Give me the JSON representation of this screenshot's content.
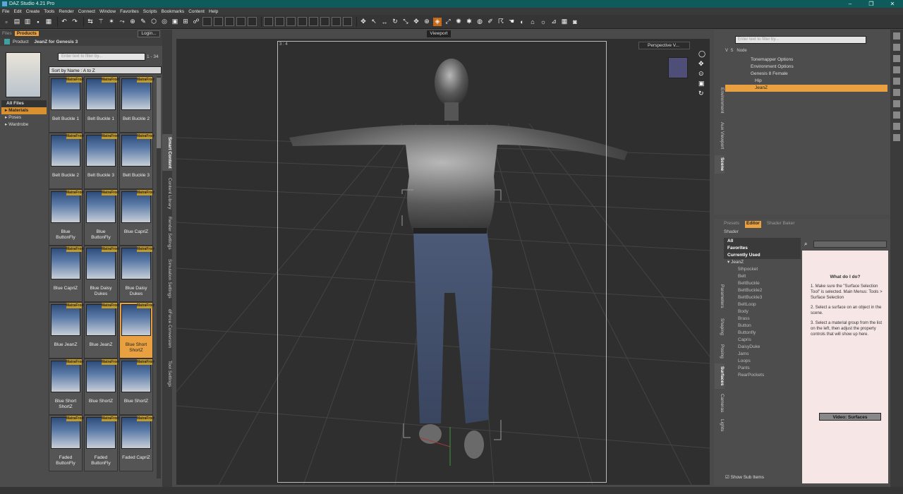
{
  "window": {
    "title": "DAZ Studio 4.21 Pro",
    "controls": [
      "–",
      "❐",
      "✕"
    ]
  },
  "menu": [
    "File",
    "Edit",
    "Create",
    "Tools",
    "Render",
    "Connect",
    "Window",
    "Favorites",
    "Scripts",
    "Bookmarks",
    "Content",
    "Help"
  ],
  "left": {
    "tabs": [
      "Files",
      "Products"
    ],
    "login": "Login...",
    "breadcrumb_prefix": "Product",
    "product": "JeanZ for Genesis 3",
    "filter_placeholder": "Enter text to filter by...",
    "count": "1 - 34",
    "sort": "Sort by Name : A to Z",
    "categories": [
      "All Files",
      "Materials",
      "Poses",
      "Wardrobe"
    ],
    "badge": "MatraFrom",
    "items": [
      "Belt Buckle 1",
      "Belt Buckle 1",
      "Belt Buckle 2",
      "Belt Buckle 2",
      "Belt Buckle 3",
      "Belt Buckle 3",
      "Blue ButtonFly",
      "Blue ButtonFly",
      "Blue CapriZ",
      "Blue CapriZ",
      "Blue Daisy Dukes",
      "Blue Daisy Dukes",
      "Blue JeanZ",
      "Blue JeanZ",
      "Blue Short ShortZ",
      "Blue Short ShortZ",
      "Blue ShortZ",
      "Blue ShortZ",
      "Faded ButtonFly",
      "Faded ButtonFly",
      "Faded CapriZ"
    ]
  },
  "side_tabs": [
    "Smart Content",
    "Content Library",
    "Render Settings",
    "Simulation Settings",
    "dForce Conversion",
    "Tool Settings"
  ],
  "viewport": {
    "label": "Viewport",
    "ratio": "3 : 4",
    "camera": "Perspective V..."
  },
  "scene": {
    "filter_placeholder": "Enter text to filter by...",
    "cols": [
      "V",
      "S",
      "Node"
    ],
    "nodes": [
      "Tonemapper Options",
      "Environment Options",
      "Genesis 8 Female",
      "Hip",
      "JeanZ"
    ],
    "tabs": [
      "Environment",
      "Aux Viewport",
      "Scene"
    ]
  },
  "surfaces": {
    "tabs": [
      "Presets",
      "Editor",
      "Shader Baker"
    ],
    "shader": "Shader",
    "groups": [
      "All",
      "Favorites",
      "Currently Used"
    ],
    "root": "JeanZ",
    "items": [
      "5thpocket",
      "Belt",
      "BeltBuckle",
      "BeltBuckle2",
      "BeltBuckle3",
      "BeltLoop",
      "Body",
      "Brass",
      "Button",
      "Buttonfly",
      "Capris",
      "DaisyDuke",
      "Jams",
      "Loops",
      "Pants",
      "RearPockets"
    ],
    "help_title": "What do I do?",
    "help": [
      "1. Make sure the \"Surface Selection Tool\" is selected. Main Menus: Tools > Surface Selection",
      "2. Select a surface on an object in the scene.",
      "3. Select a material group from the list on the left, then adjust the property controls that will show up here."
    ],
    "video": "Video: Surfaces",
    "subitems": "Show Sub Items",
    "side_tabs": [
      "Parameters",
      "Shaping",
      "Posing",
      "Surfaces",
      "Cameras",
      "Lights"
    ]
  }
}
